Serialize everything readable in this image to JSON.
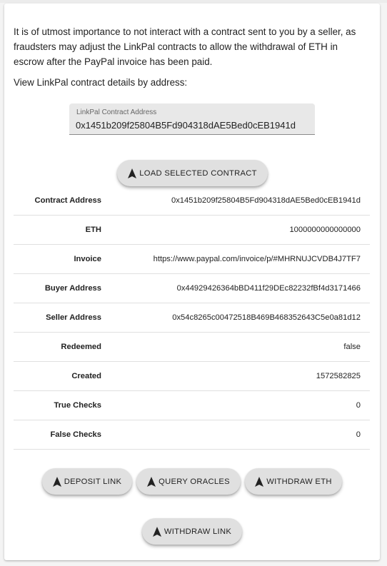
{
  "warning": "It is of utmost importance to not interact with a contract sent to you by a seller, as fraudsters may adjust the LinkPal contracts to allow the withdrawal of ETH in escrow after the PayPal invoice has been paid.",
  "view_label": "View LinkPal contract details by address:",
  "address_field": {
    "label": "LinkPal Contract Address",
    "value": "0x1451b209f25804B5Fd904318dAE5Bed0cEB1941d"
  },
  "buttons": {
    "load": "LOAD SELECTED CONTRACT",
    "deposit": "DEPOSIT LINK",
    "query": "QUERY ORACLES",
    "withdraw_eth": "WITHDRAW ETH",
    "withdraw_link": "WITHDRAW LINK"
  },
  "details": [
    {
      "key": "Contract Address",
      "value": "0x1451b209f25804B5Fd904318dAE5Bed0cEB1941d"
    },
    {
      "key": "ETH",
      "value": "1000000000000000"
    },
    {
      "key": "Invoice",
      "value": "https://www.paypal.com/invoice/p/#MHRNUJCVDB4J7TF7"
    },
    {
      "key": "Buyer Address",
      "value": "0x44929426364bBD411f29DEc82232fBf4d3171466"
    },
    {
      "key": "Seller Address",
      "value": "0x54c8265c00472518B469B468352643C5e0a81d12"
    },
    {
      "key": "Redeemed",
      "value": "false"
    },
    {
      "key": "Created",
      "value": "1572582825"
    },
    {
      "key": "True Checks",
      "value": "0"
    },
    {
      "key": "False Checks",
      "value": "0"
    }
  ],
  "icons": {
    "button_icon": "navigation-arrow-icon"
  },
  "colors": {
    "button_bg": "#e0e0e0",
    "field_bg": "#e8e8e8"
  }
}
